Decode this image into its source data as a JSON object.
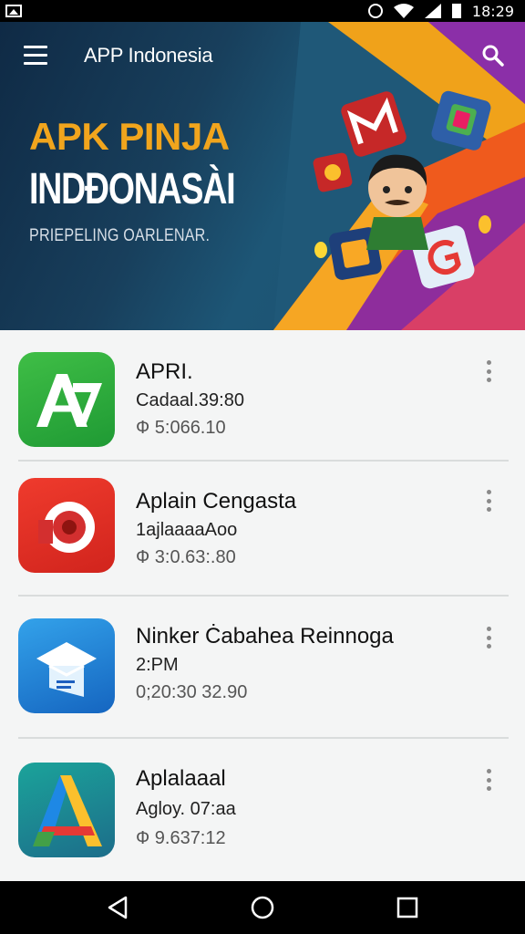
{
  "status_bar": {
    "time": "18:29",
    "icons": [
      "gallery-icon",
      "alarm-icon",
      "wifi-icon",
      "signal-icon",
      "battery-icon"
    ]
  },
  "toolbar": {
    "title": "APP Indonesia",
    "menu_icon": "hamburger-menu-icon",
    "search_icon": "search-icon"
  },
  "hero": {
    "title_line1": "APK PINJA",
    "title_line2": "INDÐONASÀI",
    "subtitle": "PRIEPELING OARLENAR.",
    "colors": {
      "title1": "#f1a51d",
      "title2": "#ffffff"
    }
  },
  "list": {
    "items": [
      {
        "title": "APRI.",
        "line2": "Cadaal.39:80",
        "line3": "Ф 5:066.10",
        "icon": "green-a-app-icon"
      },
      {
        "title": "Aplain Cengasta",
        "line2": "1ajlaaaaAoo",
        "line3": "Ф 3:0.63:.80",
        "icon": "red-circle-app-icon"
      },
      {
        "title": "Ninker Ċabahea Reinnoga",
        "line2": "2:PM",
        "line3": "0;20:30 32.90",
        "icon": "blue-graduation-app-icon"
      },
      {
        "title": "Aplalaaal",
        "line2": "Agloy. 07:aa",
        "line3": "Ф 9.637:12",
        "icon": "multicolor-a-app-icon"
      }
    ],
    "more_icon": "more-vert-icon"
  },
  "nav_bar": {
    "icons": [
      "back-icon",
      "home-icon",
      "recents-icon"
    ]
  }
}
